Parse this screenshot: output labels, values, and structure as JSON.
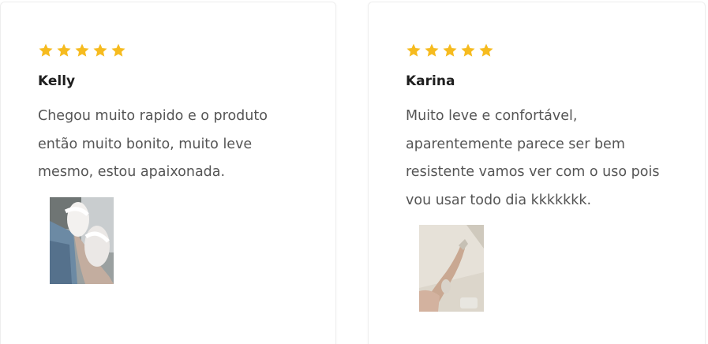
{
  "star_color": "#f6bb1f",
  "reviews": [
    {
      "rating": 5,
      "name": "Kelly",
      "text": "Chegou muito rapido e o produto então muito bonito, muito leve mesmo, estou apaixonada.",
      "photo_icon": "review-photo-white-slides"
    },
    {
      "rating": 5,
      "name": "Karina",
      "text": "Muito leve e confortável, aparentemente parece ser bem resistente vamos ver com o uso pois vou usar todo dia kkkkkkk.",
      "photo_icon": "review-photo-legs-flipflops"
    }
  ]
}
